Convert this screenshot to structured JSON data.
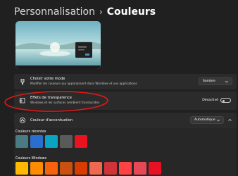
{
  "breadcrumb": {
    "parent": "Personnalisation",
    "separator": "›",
    "current": "Couleurs"
  },
  "mode_row": {
    "icon": "palette-brush-icon",
    "title": "Choisir votre mode",
    "subtitle": "Modifier les couleurs qui apparaissent dans Windows et vos applications",
    "dropdown_value": "Sombre"
  },
  "transparency_row": {
    "icon": "transparency-icon",
    "title": "Effets de transparence",
    "subtitle": "Windows et les surfaces semblent translucides",
    "toggle_label": "Désactivé",
    "toggle_on": false
  },
  "accent_row": {
    "icon": "accent-color-icon",
    "title": "Couleur d'accentuation",
    "dropdown_value": "Automatique",
    "expanded": true
  },
  "recent_colors": {
    "label": "Couleurs récentes",
    "colors": [
      "#4a7b82",
      "#2a6fd0",
      "#0aa3c2",
      "#5a5a5a",
      "#e8131f"
    ]
  },
  "windows_colors": {
    "label": "Couleurs Windows",
    "colors": [
      "#ffb900",
      "#ff8c00",
      "#f7630c",
      "#ca5010",
      "#da3b01",
      "#ef6950",
      "#d13438",
      "#ff4343",
      "#e74856",
      "#e81123"
    ]
  },
  "colors": {
    "annotation_circle": "#e01818",
    "toggle_outline": "#cfcfcf"
  }
}
